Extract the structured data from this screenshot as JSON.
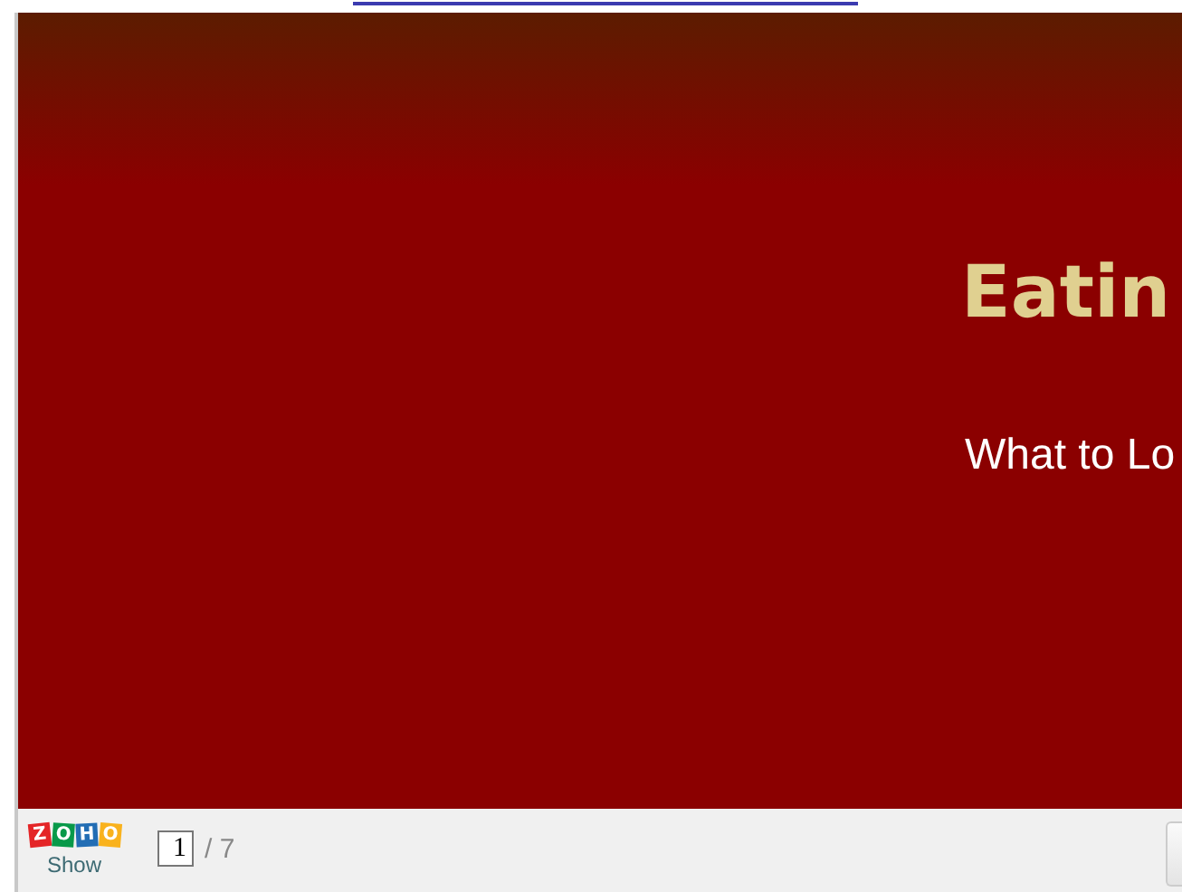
{
  "slide": {
    "title": "Eatin",
    "subtitle": "What to Lo"
  },
  "toolbar": {
    "logo": {
      "tiles": [
        {
          "letter": "Z",
          "color": "#e42527"
        },
        {
          "letter": "O",
          "color": "#089949"
        },
        {
          "letter": "H",
          "color": "#226db4"
        },
        {
          "letter": "O",
          "color": "#f9b21d"
        }
      ],
      "caption": "Show"
    },
    "page": {
      "value": "1",
      "total": "/ 7"
    }
  }
}
